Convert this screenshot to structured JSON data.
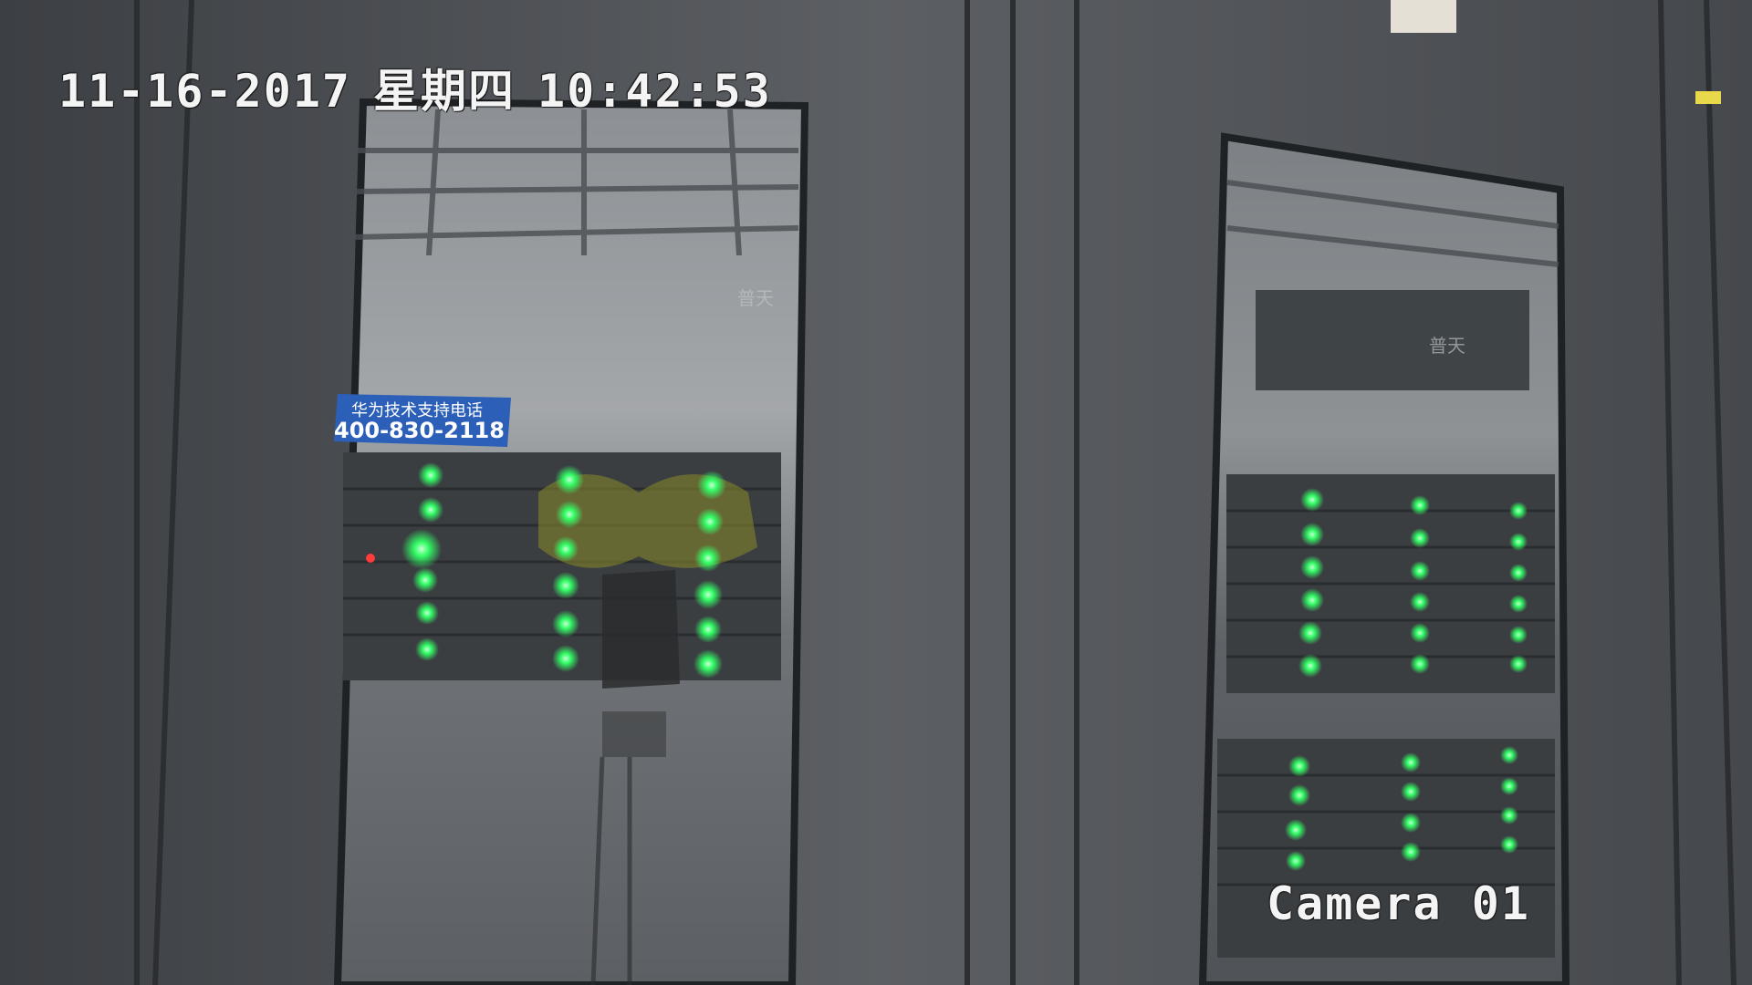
{
  "osd": {
    "date": "11-16-2017",
    "weekday": "星期四",
    "time": "10:42:53",
    "camera": "Camera 01"
  },
  "scene": {
    "sign_text_1": "华为技术支持电话",
    "sign_text_2": "400-830-2118",
    "reflection_text": "普天",
    "led_color": "#33ff66",
    "cabinet_color": "#5a5d61"
  }
}
